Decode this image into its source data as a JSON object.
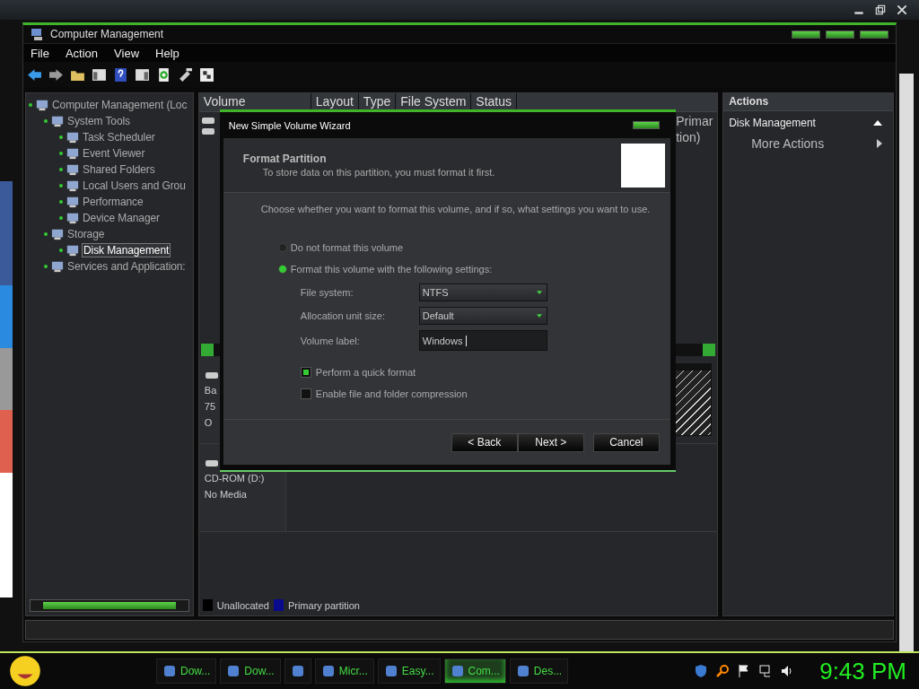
{
  "window": {
    "title": "Computer Management"
  },
  "menu": [
    "File",
    "Action",
    "View",
    "Help"
  ],
  "tree": [
    {
      "label": "Computer Management (Loc",
      "selected": false,
      "children": [
        {
          "label": "System Tools",
          "selected": false,
          "children": [
            {
              "label": "Task Scheduler",
              "selected": false
            },
            {
              "label": "Event Viewer",
              "selected": false
            },
            {
              "label": "Shared Folders",
              "selected": false
            },
            {
              "label": "Local Users and Grou",
              "selected": false
            },
            {
              "label": "Performance",
              "selected": false
            },
            {
              "label": "Device Manager",
              "selected": false
            }
          ]
        },
        {
          "label": "Storage",
          "selected": false,
          "children": [
            {
              "label": "Disk Management",
              "selected": true
            }
          ]
        },
        {
          "label": "Services and Application:",
          "selected": false
        }
      ]
    }
  ],
  "volume_table": {
    "columns": [
      "Volume",
      "Layout",
      "Type",
      "File System",
      "Status"
    ],
    "partial_cells": [
      "Primar",
      "tion)"
    ]
  },
  "disks": [
    {
      "lines": [
        "Ba",
        "75",
        "O"
      ]
    },
    {
      "lines": [
        "CD-ROM (D:)",
        "No Media"
      ]
    }
  ],
  "legend": [
    {
      "label": "Unallocated",
      "color": "#000000"
    },
    {
      "label": "Primary partition",
      "color": "#0a0a8c"
    }
  ],
  "actions": {
    "title": "Actions",
    "section": "Disk Management",
    "items": [
      "More Actions"
    ]
  },
  "dialog": {
    "title": "New Simple Volume Wizard",
    "heading": "Format Partition",
    "subheading": "To store data on this partition, you must format it first.",
    "prompt": "Choose whether you want to format this volume, and if so, what settings you want to use.",
    "options": [
      {
        "label": "Do not format this volume",
        "selected": false
      },
      {
        "label": "Format this volume with the following settings:",
        "selected": true
      }
    ],
    "fields": [
      {
        "label": "File system:",
        "value": "NTFS",
        "kind": "dropdown"
      },
      {
        "label": "Allocation unit size:",
        "value": "Default",
        "kind": "dropdown"
      },
      {
        "label": "Volume label:",
        "value": "Windows",
        "kind": "text"
      }
    ],
    "checkboxes": [
      {
        "label": "Perform a quick format",
        "checked": true
      },
      {
        "label": "Enable file and folder compression",
        "checked": false
      }
    ],
    "buttons": [
      "< Back",
      "Next >",
      "Cancel"
    ]
  },
  "taskbar": {
    "items": [
      {
        "label": "Dow...",
        "selected": false
      },
      {
        "label": "Dow...",
        "selected": false
      },
      {
        "selected": false
      },
      {
        "label": "Micr...",
        "selected": false
      },
      {
        "label": "Easy...",
        "selected": false
      },
      {
        "label": "Com...",
        "selected": true
      },
      {
        "label": "Des...",
        "selected": false
      }
    ],
    "clock": "9:43 PM"
  }
}
